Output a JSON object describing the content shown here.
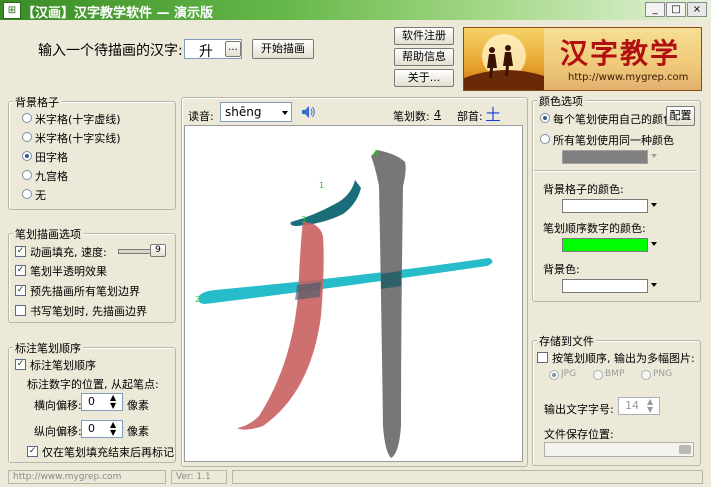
{
  "window": {
    "title": "【汉画】汉字教学软件 — 演示版",
    "app_icon": "grid-icon",
    "buttons": {
      "minimize": "_",
      "maximize": "□",
      "close": "×"
    }
  },
  "top": {
    "input_label": "输入一个待描画的汉字:",
    "input_value": "升",
    "browse_label": "...",
    "start_label": "开始描画",
    "register_label": "软件注册",
    "help_label": "帮助信息",
    "about_label": "关于..."
  },
  "logo": {
    "title": "汉字教学",
    "url": "http://www.mygrep.com"
  },
  "background_grid": {
    "title": "背景格子",
    "options": [
      "米字格(十字虚线)",
      "米字格(十字实线)",
      "田字格",
      "九宫格",
      "无"
    ],
    "selected": "田字格"
  },
  "animation": {
    "title": "笔划描画选项",
    "anim_fill_label": "动画填充, 速度:",
    "speed_value": "9",
    "semi_transparent_label": "笔划半透明效果",
    "predraw_border_label": "预先描画所有笔划边界",
    "draw_border_first_label": "书写笔划时, 先描画边界",
    "checks": {
      "anim_fill": true,
      "semi_transparent": true,
      "predraw_border": true,
      "draw_border_first": false
    }
  },
  "order": {
    "title": "标注笔划顺序",
    "mark_label": "标注笔划顺序",
    "position_label": "标注数字的位置, 从起笔点:",
    "h_offset_label": "横向偏移:",
    "h_offset_value": "0",
    "v_offset_label": "纵向偏移:",
    "v_offset_value": "0",
    "unit": "像素",
    "mark_after_label": "仅在笔划填充结束后再标记",
    "checks": {
      "mark": true,
      "mark_after": true
    }
  },
  "canvas_header": {
    "reading_label": "读音:",
    "reading_value": "shēng",
    "stroke_count_label": "笔划数:",
    "stroke_count_value": "4",
    "radical_label": "部首:",
    "radical_value": "十",
    "speaker_icon": "speaker-icon"
  },
  "strokes": {
    "numbers": [
      "1",
      "2",
      "3",
      "4"
    ],
    "colors": {
      "s1": "#1a6e7a",
      "s2": "#1ab8c6",
      "s3": "#c96060",
      "s4": "#707070",
      "number": "#2ec42e"
    }
  },
  "color_options": {
    "title": "颜色选项",
    "each_stroke_label": "每个笔划使用自己的颜色",
    "config_label": "配置",
    "same_color_label": "所有笔划使用同一种颜色",
    "selected": "each_stroke",
    "grid_color_label": "背景格子的颜色:",
    "order_color_label": "笔划顺序数字的颜色:",
    "bg_color_label": "背景色:",
    "colors": {
      "same": "#808080",
      "grid": "#ffffff",
      "order": "#00ff00",
      "bg": "#ffffff"
    }
  },
  "save": {
    "title": "存储到文件",
    "multi_label": "按笔划顺序, 输出为多幅图片:",
    "formats": [
      "JPG",
      "BMP",
      "PNG"
    ],
    "format_selected": "JPG",
    "font_size_label": "输出文字字号:",
    "font_size_value": "14",
    "path_label": "文件保存位置:",
    "checks": {
      "multi": false
    }
  },
  "status": {
    "website": "http://www.mygrep.com",
    "version": "Ver: 1.1"
  }
}
